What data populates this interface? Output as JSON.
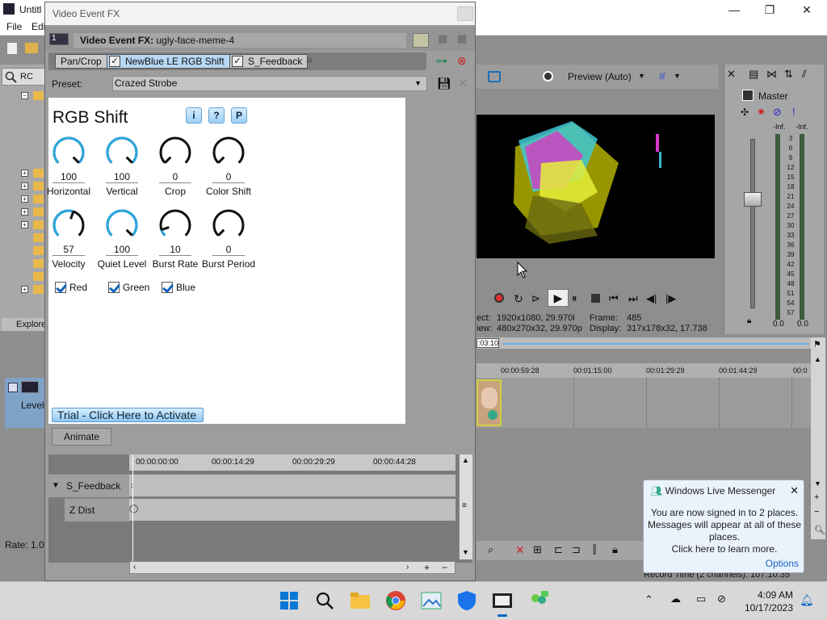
{
  "app": {
    "title": "Untitl",
    "menu": [
      "File",
      "Edi"
    ],
    "controls": [
      "—",
      "❐",
      "✕"
    ]
  },
  "left_panel": {
    "search_placeholder": "RC",
    "explorer_tab": "Explore",
    "level_label": "Level:",
    "rate_label": "Rate: 1.0"
  },
  "fx": {
    "window_title": "Video Event FX",
    "event_number": "1",
    "header_label": "Video Event FX:",
    "event_name": "ugly-face-meme-4",
    "chain": [
      {
        "label": "Pan/Crop",
        "active": false,
        "checkbox": false
      },
      {
        "label": "NewBlue LE RGB Shift",
        "active": true,
        "checkbox": true
      },
      {
        "label": "S_Feedback",
        "active": false,
        "checkbox": true
      }
    ],
    "preset_label": "Preset:",
    "preset_value": "Crazed Strobe",
    "plugin": {
      "title": "RGB Shift",
      "info_buttons": [
        "i",
        "?",
        "P"
      ],
      "knobs": [
        {
          "value": "100",
          "label": "Horizontal"
        },
        {
          "value": "100",
          "label": "Vertical"
        },
        {
          "value": "0",
          "label": "Crop"
        },
        {
          "value": "0",
          "label": "Color Shift"
        },
        {
          "value": "57",
          "label": "Velocity"
        },
        {
          "value": "100",
          "label": "Quiet Level"
        },
        {
          "value": "10",
          "label": "Burst Rate"
        },
        {
          "value": "0",
          "label": "Burst Period"
        }
      ],
      "knob_levels": [
        1.0,
        1.0,
        0,
        0,
        0.57,
        1.0,
        0.1,
        0
      ],
      "channels": [
        "Red",
        "Green",
        "Blue"
      ],
      "trial_button": "Trial - Click Here to Activate"
    },
    "animate_button": "Animate",
    "keyframes": {
      "ruler": [
        "00:00:00:00",
        "00:00:14:29",
        "00:00:29:29",
        "00:00:44:28"
      ],
      "rows": [
        "S_Feedback",
        "Z Dist"
      ]
    }
  },
  "preview": {
    "mode": "Preview (Auto)",
    "info": {
      "project_label": "ect:",
      "project_value": "1920x1080, 29.970i",
      "preview_label": "iew:",
      "preview_value": "480x270x32, 29.970p",
      "frame_label": "Frame:",
      "frame_value": "485",
      "display_label": "Display:",
      "display_value": "317x178x32, 17.738"
    }
  },
  "master": {
    "title": "Master",
    "db_top_left": "-Inf.",
    "db_top_right": "-Inf.",
    "scale": [
      "3",
      "6",
      "9",
      "12",
      "15",
      "18",
      "21",
      "24",
      "27",
      "30",
      "33",
      "36",
      "39",
      "42",
      "45",
      "48",
      "51",
      "54",
      "57"
    ],
    "db_bottom_left": "0.0",
    "db_bottom_right": "0.0"
  },
  "timeline": {
    "top_time": ":03:10",
    "ruler": [
      "00:00:59:28",
      "00:01:15:00",
      "00:01:29:29",
      "00:01:44:29",
      "00:0"
    ],
    "record_time": "Record Time (2 channels): 107:10:35"
  },
  "notification": {
    "title": "Windows Live Messenger",
    "message": "You are now signed in to 2 places. Messages will appear at all of these places.",
    "link": "Click here to learn more.",
    "options": "Options"
  },
  "taskbar": {
    "time": "4:09 AM",
    "date": "10/17/2023"
  },
  "colors": {
    "knob_accent": "#29a8e0",
    "checkbox_blue": "#1565c0"
  }
}
